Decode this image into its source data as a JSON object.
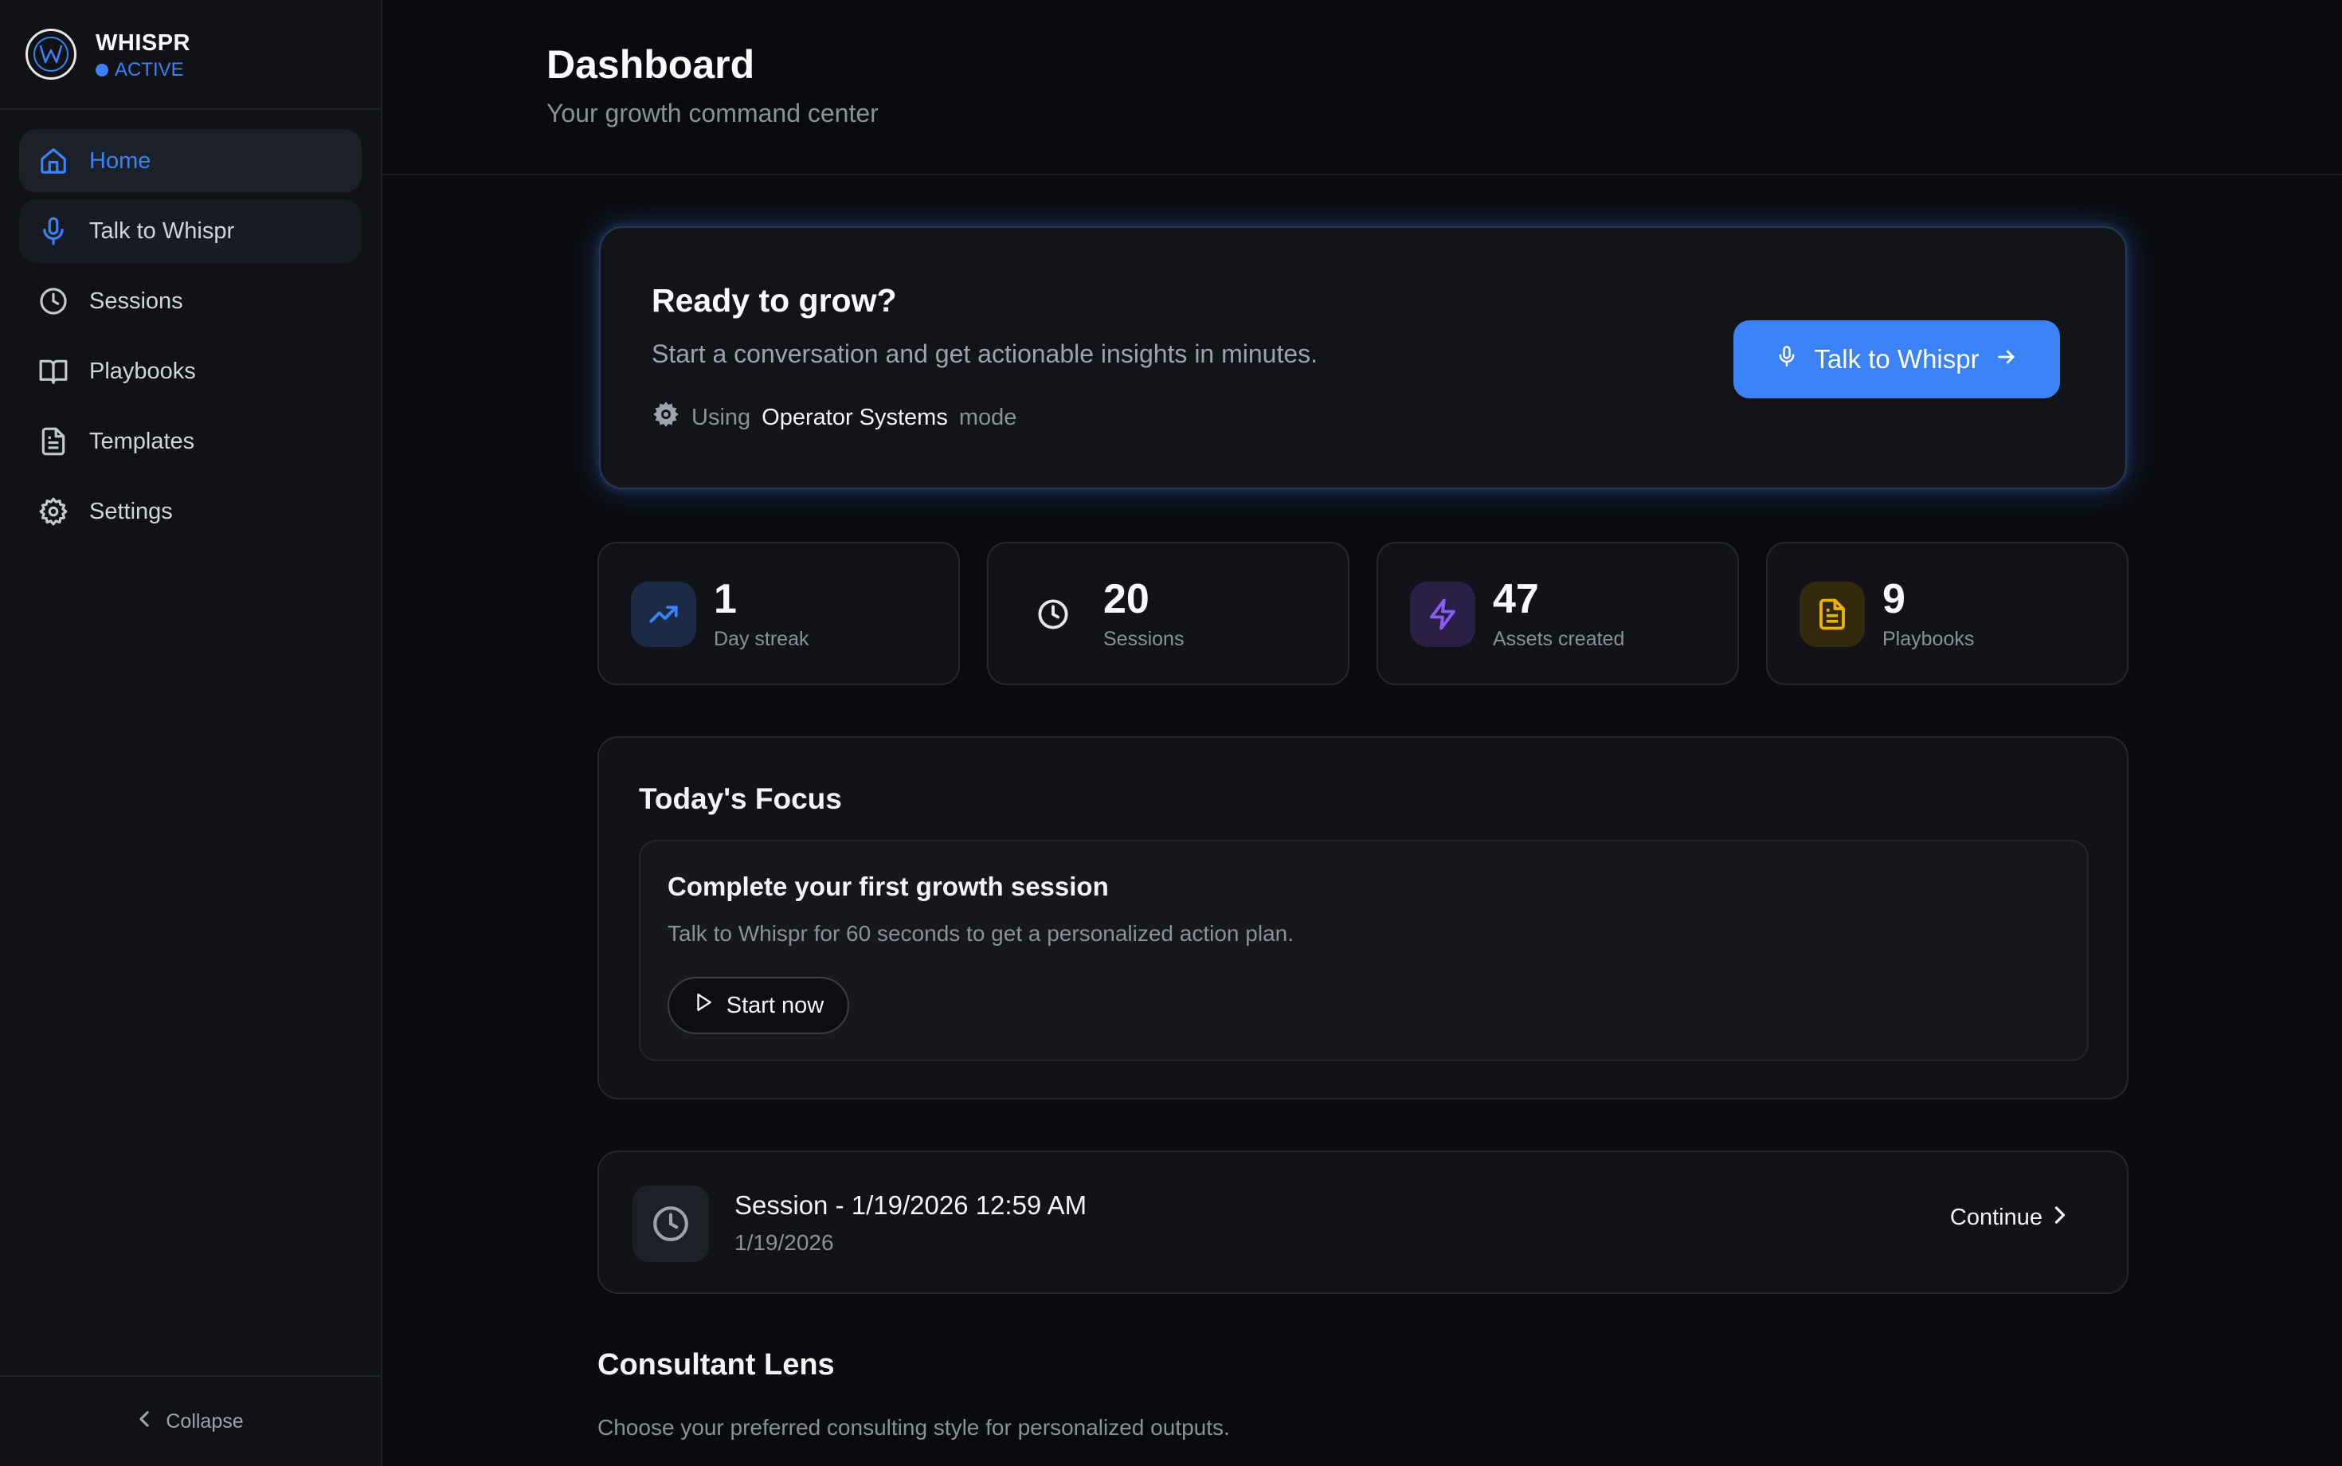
{
  "brand": {
    "name": "WHISPR",
    "status": "ACTIVE"
  },
  "sidebar": {
    "items": [
      {
        "label": "Home",
        "icon": "home-icon"
      },
      {
        "label": "Talk to Whispr",
        "icon": "mic-icon"
      },
      {
        "label": "Sessions",
        "icon": "clock-icon"
      },
      {
        "label": "Playbooks",
        "icon": "book-icon"
      },
      {
        "label": "Templates",
        "icon": "document-icon"
      },
      {
        "label": "Settings",
        "icon": "gear-icon"
      }
    ],
    "collapse_label": "Collapse"
  },
  "header": {
    "title": "Dashboard",
    "subtitle": "Your growth command center"
  },
  "hero": {
    "title": "Ready to grow?",
    "description": "Start a conversation and get actionable insights in minutes.",
    "mode_prefix": "Using",
    "mode_name": "Operator Systems",
    "mode_suffix": "mode",
    "button_label": "Talk to Whispr"
  },
  "stats": [
    {
      "value": "1",
      "label": "Day streak",
      "icon": "trending-up-icon",
      "color": "#3b82f6"
    },
    {
      "value": "20",
      "label": "Sessions",
      "icon": "clock-icon",
      "color": "#e5e7eb"
    },
    {
      "value": "47",
      "label": "Assets created",
      "icon": "lightning-icon",
      "color": "#8b5cf6"
    },
    {
      "value": "9",
      "label": "Playbooks",
      "icon": "document-icon",
      "color": "#eab308"
    }
  ],
  "focus": {
    "title": "Today's Focus",
    "card_title": "Complete your first growth session",
    "card_description": "Talk to Whispr for 60 seconds to get a personalized action plan.",
    "button_label": "Start now"
  },
  "session": {
    "title": "Session - 1/19/2026 12:59 AM",
    "date": "1/19/2026",
    "continue_label": "Continue"
  },
  "lens": {
    "title": "Consultant Lens",
    "description": "Choose your preferred consulting style for personalized outputs."
  },
  "colors": {
    "accent": "#3b82f6",
    "background": "#0a0b0e",
    "sidebar": "#101216"
  }
}
